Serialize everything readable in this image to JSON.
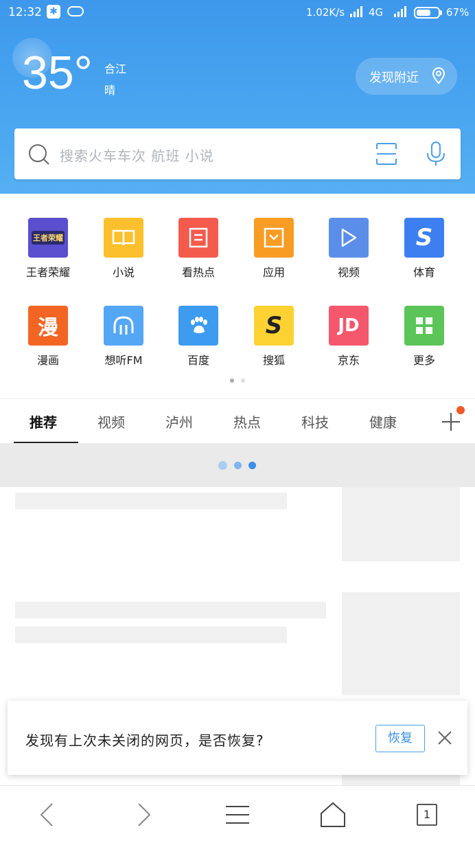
{
  "status_bar": {
    "time": "12:32",
    "speed": "1.02K/s",
    "network": "4G",
    "battery": "67%",
    "battery_level": 0.67
  },
  "weather": {
    "temperature": "35°",
    "city": "合江",
    "condition": "晴"
  },
  "nearby": {
    "label": "发现附近",
    "icon": "location-pin-icon"
  },
  "search": {
    "placeholder": "搜索火车车次 航班 小说",
    "scan_icon": "scan-icon",
    "voice_icon": "microphone-icon"
  },
  "shortcuts": [
    {
      "label": "王者荣耀",
      "glyph": "王者荣耀",
      "color": "#5a4fcf"
    },
    {
      "label": "小说",
      "glyph": "book-icon",
      "color": "#fcc02c"
    },
    {
      "label": "看热点",
      "glyph": "news-icon",
      "color": "#f45b4d"
    },
    {
      "label": "应用",
      "glyph": "app-box-icon",
      "color": "#f89c24"
    },
    {
      "label": "视频",
      "glyph": "play-icon",
      "color": "#5b8ee9"
    },
    {
      "label": "体育",
      "glyph": "S",
      "color": "#3d7ff0"
    },
    {
      "label": "漫画",
      "glyph": "漫",
      "color": "#f26522"
    },
    {
      "label": "想听FM",
      "glyph": "headphone-icon",
      "color": "#54a7f5"
    },
    {
      "label": "百度",
      "glyph": "paw-icon",
      "color": "#3d9bf0"
    },
    {
      "label": "搜狐",
      "glyph": "S",
      "color": "#fcd232"
    },
    {
      "label": "京东",
      "glyph": "JD",
      "color": "#f5576c"
    },
    {
      "label": "更多",
      "glyph": "grid-icon",
      "color": "#5cc55a"
    }
  ],
  "tabs": [
    {
      "label": "推荐",
      "active": true
    },
    {
      "label": "视频",
      "active": false
    },
    {
      "label": "泸州",
      "active": false
    },
    {
      "label": "热点",
      "active": false
    },
    {
      "label": "科技",
      "active": false
    },
    {
      "label": "健康",
      "active": false
    }
  ],
  "toast": {
    "message": "发现有上次未关闭的网页，是否恢复?",
    "restore_label": "恢复"
  },
  "bottom_nav": {
    "tab_count": "1"
  },
  "colors": {
    "header_blue": "#4aa6f0",
    "accent": "#3a8fdf",
    "badge_red": "#f0592a"
  }
}
